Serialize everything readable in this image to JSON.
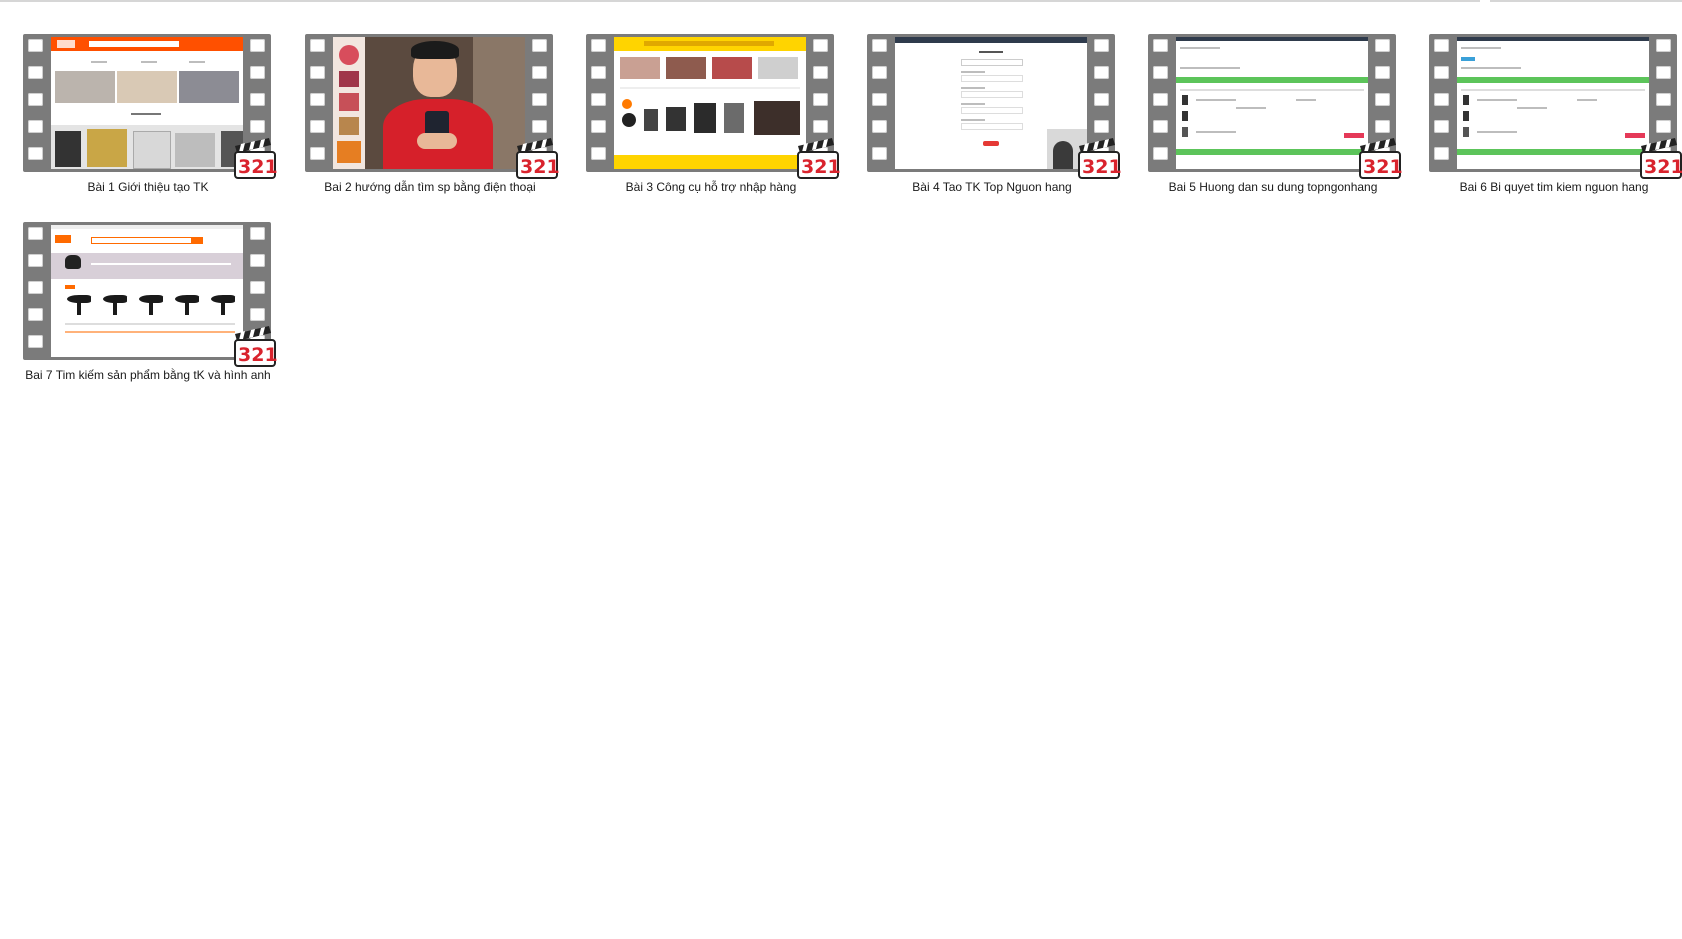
{
  "files": [
    {
      "name": "Bài 1 Giới thiệu tạo TK"
    },
    {
      "name": "Bai 2 hướng dẫn tìm sp bằng điện thoại"
    },
    {
      "name": "Bài 3 Công cụ hỗ trợ nhập hàng"
    },
    {
      "name": "Bài 4 Tao TK Top Nguon hang"
    },
    {
      "name": "Bai 5 Huong dan su dung topngonhang"
    },
    {
      "name": "Bai 6 Bi quyet tim kiem nguon hang"
    },
    {
      "name": "Bai 7 Tim kiếm sản phẩm bằng tK và hình anh"
    }
  ],
  "badge_text": "321",
  "icons": {
    "filmstrip": "film-strip-icon",
    "badge": "media-player-classic-321-icon"
  },
  "colors": {
    "film": "#7b7b7b",
    "badge_red": "#d9232d",
    "badge_blue": "#1f6fd1",
    "badge_green": "#2f9e44",
    "taobao_orange": "#ff5000",
    "yellow": "#ffd400",
    "green_bar": "#5cc45a"
  }
}
